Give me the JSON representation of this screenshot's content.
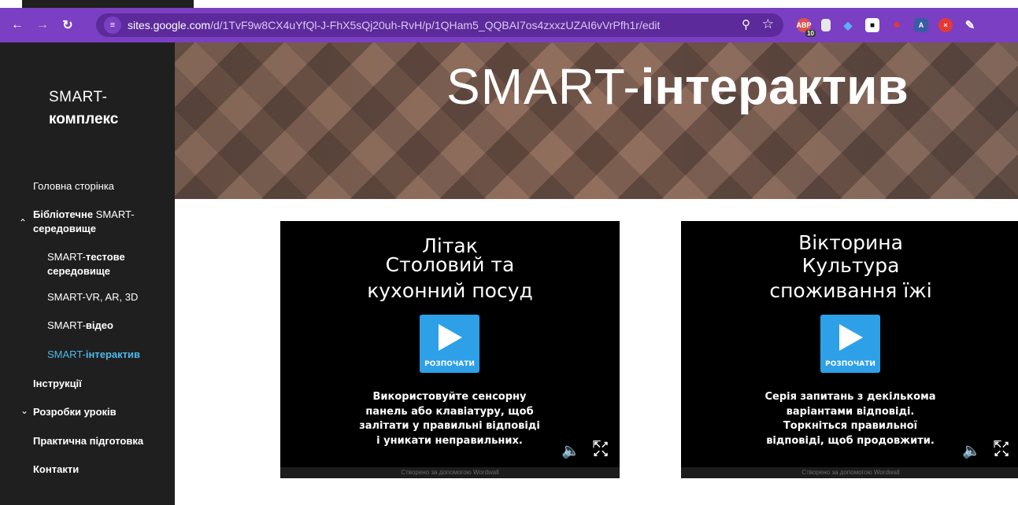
{
  "browser": {
    "back_icon": "arrow-left-icon",
    "forward_icon": "arrow-right-icon",
    "reload_icon": "reload-icon",
    "url_host": "sites.google.com",
    "url_path": "/d/1TvF9w8CX4uYfQl-J-FhX5sQj20uh-RvH/p/1QHam5_QQBAI7os4zxxzUZAI6vVrPfh1r/edit",
    "extension_badge": "10",
    "toolbar_color": "#7a3fc2"
  },
  "sidebar": {
    "site_title_line1": "SMART-",
    "site_title_line2": "комплекс",
    "items": [
      {
        "label": "Головна сторінка"
      },
      {
        "label_a": "Бібліотечне ",
        "label_b": "SMART-",
        "label_c": "середовище"
      },
      {
        "label_a": "SMART-",
        "label_b": "тестове",
        "label_c": "середовище"
      },
      {
        "label": "SMART-VR, AR, 3D"
      },
      {
        "label_a": "SMART-",
        "label_b": "відео"
      },
      {
        "label_a": "SMART-",
        "label_b": "інтерактив"
      },
      {
        "label": "Інструкції"
      },
      {
        "label": "Розробки уроків"
      },
      {
        "label": "Практична підготовка"
      },
      {
        "label": "Контакти"
      }
    ],
    "active_color": "#4fb8e8"
  },
  "banner": {
    "title_a": "SMART-",
    "title_b": "інтерактив"
  },
  "cards": [
    {
      "title_lines": [
        "Літак",
        "Столовий та",
        "кухонний посуд"
      ],
      "start_label": "РОЗПОЧАТИ",
      "desc_lines": [
        "Використовуйте сенсорну",
        "панель або клавіатуру, щоб",
        "залітати у правильні відповіді",
        "і уникати неправильних."
      ],
      "footer": "Створено за допомогою Wordwall"
    },
    {
      "title_lines": [
        "Вікторина",
        "Культура",
        "споживання їжі"
      ],
      "start_label": "РОЗПОЧАТИ",
      "desc_lines": [
        "Серія запитань з декількома",
        "варіантами відповіді.",
        "Торкніться правильної",
        "відповіді, щоб продовжити."
      ],
      "footer": "Створено за допомогою Wordwall"
    }
  ]
}
